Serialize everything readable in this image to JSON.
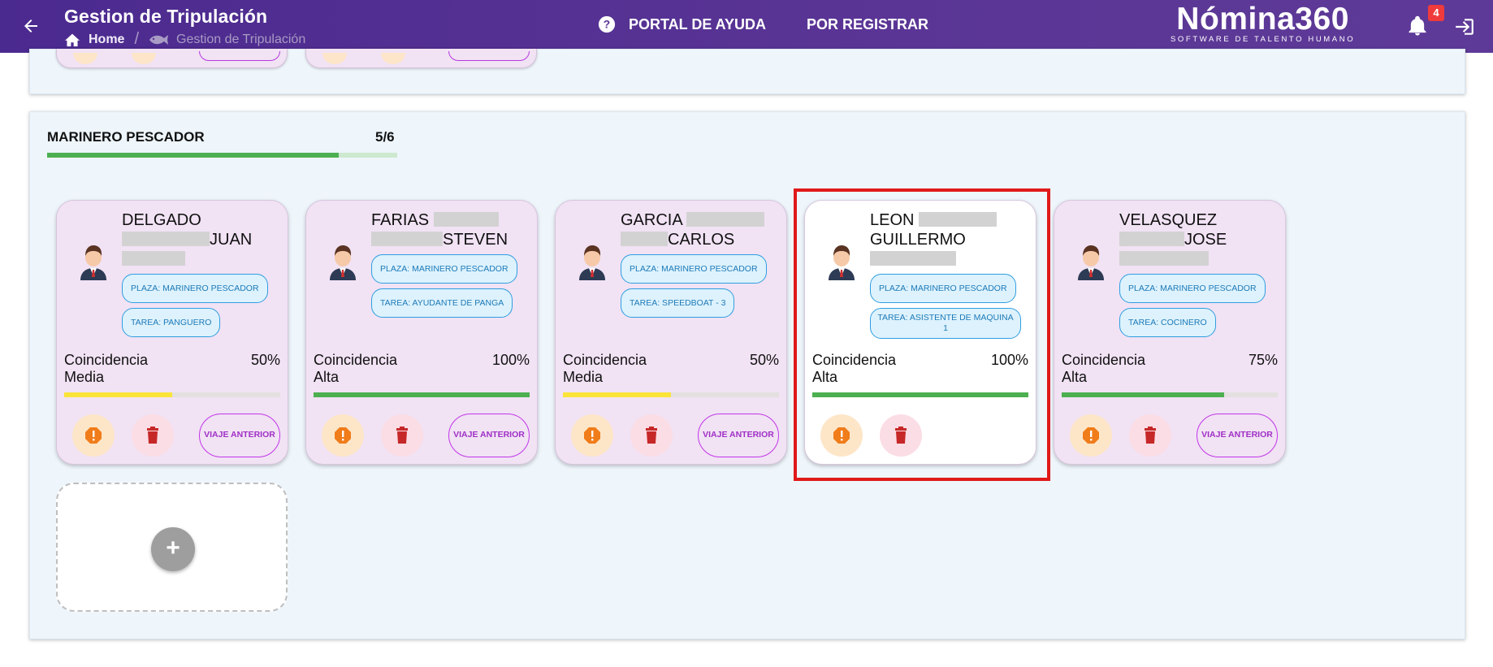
{
  "header": {
    "title": "Gestion de Tripulación",
    "breadcrumb_home": "Home",
    "breadcrumb_current": "Gestion de Tripulación",
    "nav_help": "PORTAL DE AYUDA",
    "nav_register": "POR REGISTRAR",
    "brand_name": "Nómina360",
    "brand_tagline": "SOFTWARE DE TALENTO HUMANO",
    "notification_count": "4"
  },
  "section": {
    "title": "MARINERO PESCADOR",
    "count": "5/6",
    "progress": 0.833
  },
  "cards": [
    {
      "last_name": "DELGADO",
      "first_name": "JUAN",
      "plaza": "PLAZA: MARINERO PESCADOR",
      "tarea": "TAREA: PANGUERO",
      "match_label_1": "Coincidencia",
      "match_label_2": "Media",
      "match_pct": "50%",
      "match_value": 0.5,
      "bar_color": "#fbe43a",
      "prev_label": "VIAJE ANTERIOR"
    },
    {
      "last_name": "FARIAS",
      "first_name": "STEVEN",
      "plaza": "PLAZA: MARINERO PESCADOR",
      "tarea": "TAREA: AYUDANTE DE PANGA",
      "match_label_1": "Coincidencia",
      "match_label_2": "Alta",
      "match_pct": "100%",
      "match_value": 1.0,
      "bar_color": "#4caf50",
      "prev_label": "VIAJE ANTERIOR"
    },
    {
      "last_name": "GARCIA",
      "first_name": "CARLOS",
      "plaza": "PLAZA: MARINERO PESCADOR",
      "tarea": "TAREA: SPEEDBOAT - 3",
      "match_label_1": "Coincidencia",
      "match_label_2": "Media",
      "match_pct": "50%",
      "match_value": 0.5,
      "bar_color": "#fbe43a",
      "prev_label": "VIAJE ANTERIOR"
    },
    {
      "last_name": "LEON",
      "first_name": "GUILLERMO",
      "plaza": "PLAZA: MARINERO PESCADOR",
      "tarea": "TAREA: ASISTENTE DE MAQUINA 1",
      "match_label_1": "Coincidencia",
      "match_label_2": "Alta",
      "match_pct": "100%",
      "match_value": 1.0,
      "bar_color": "#4caf50"
    },
    {
      "last_name": "VELASQUEZ",
      "first_name": "JOSE",
      "plaza": "PLAZA: MARINERO PESCADOR",
      "tarea": "TAREA: COCINERO",
      "match_label_1": "Coincidencia",
      "match_label_2": "Alta",
      "match_pct": "75%",
      "match_value": 0.75,
      "bar_color": "#4caf50",
      "prev_label": "VIAJE ANTERIOR"
    }
  ],
  "add_card": {
    "icon": "+"
  },
  "colors": {
    "header": "#5a3595",
    "accent_purple": "#c236e8",
    "pill_blue": "#2f9ee0",
    "highlight": "#e01a1a"
  }
}
